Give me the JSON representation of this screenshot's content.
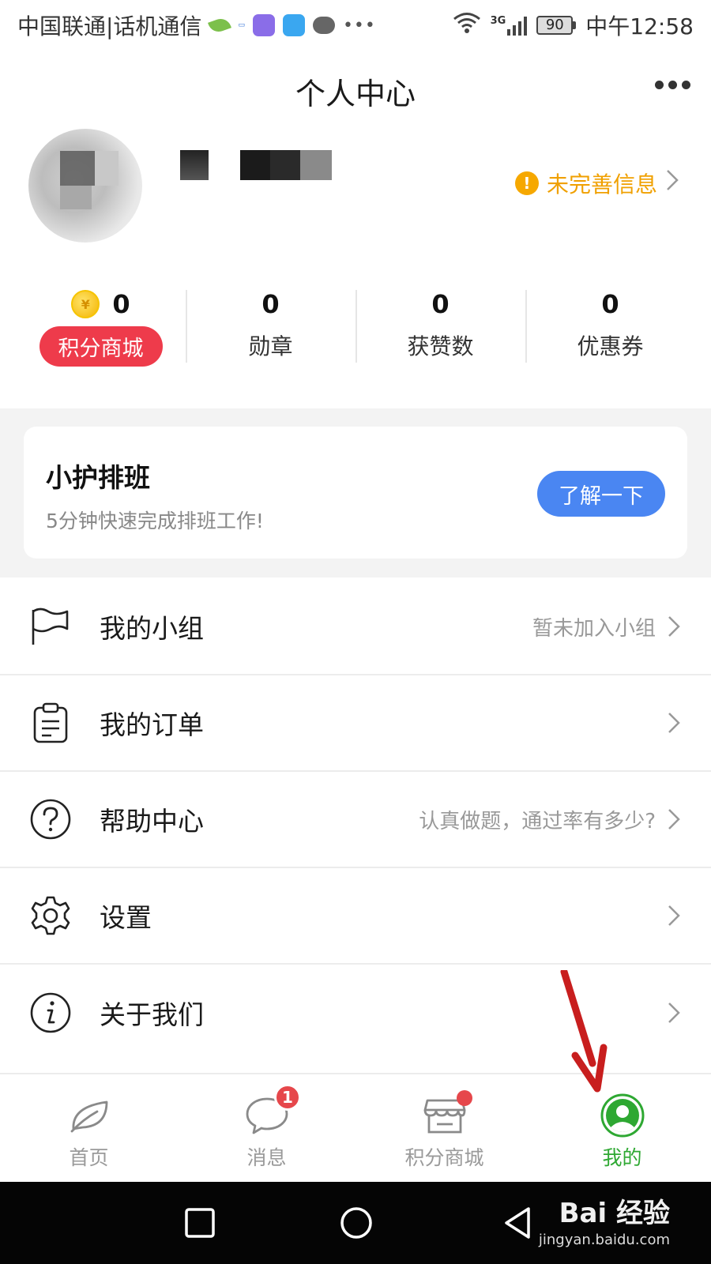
{
  "status_bar": {
    "carrier": "中国联通|话机通信",
    "network": "3G",
    "battery": "90",
    "time": "中午12:58"
  },
  "header": {
    "title": "个人中心"
  },
  "profile": {
    "incomplete_info": "未完善信息"
  },
  "stats": {
    "points_value": "0",
    "points_mall_button": "积分商城",
    "medals_value": "0",
    "medals_label": "勋章",
    "likes_value": "0",
    "likes_label": "获赞数",
    "coupons_value": "0",
    "coupons_label": "优惠券"
  },
  "promo": {
    "title": "小护排班",
    "subtitle": "5分钟快速完成排班工作!",
    "button": "了解一下"
  },
  "menu": {
    "items": [
      {
        "label": "我的小组",
        "hint": "暂未加入小组",
        "icon": "flag-icon"
      },
      {
        "label": "我的订单",
        "hint": "",
        "icon": "clipboard-icon"
      },
      {
        "label": "帮助中心",
        "hint": "认真做题，通过率有多少?",
        "icon": "question-icon"
      },
      {
        "label": "设置",
        "hint": "",
        "icon": "gear-icon"
      },
      {
        "label": "关于我们",
        "hint": "",
        "icon": "info-icon"
      }
    ]
  },
  "tabbar": {
    "items": [
      {
        "label": "首页",
        "icon": "leaf-icon"
      },
      {
        "label": "消息",
        "icon": "chat-bubble-icon",
        "badge": "1"
      },
      {
        "label": "积分商城",
        "icon": "store-icon"
      },
      {
        "label": "我的",
        "icon": "person-circle-icon"
      }
    ]
  },
  "watermark": {
    "brand": "Bai 经验",
    "url": "jingyan.baidu.com"
  },
  "colors": {
    "accent_red": "#ee3b4b",
    "accent_blue": "#4a86f2",
    "active_green": "#2ea832",
    "warning_orange": "#f0a000"
  }
}
